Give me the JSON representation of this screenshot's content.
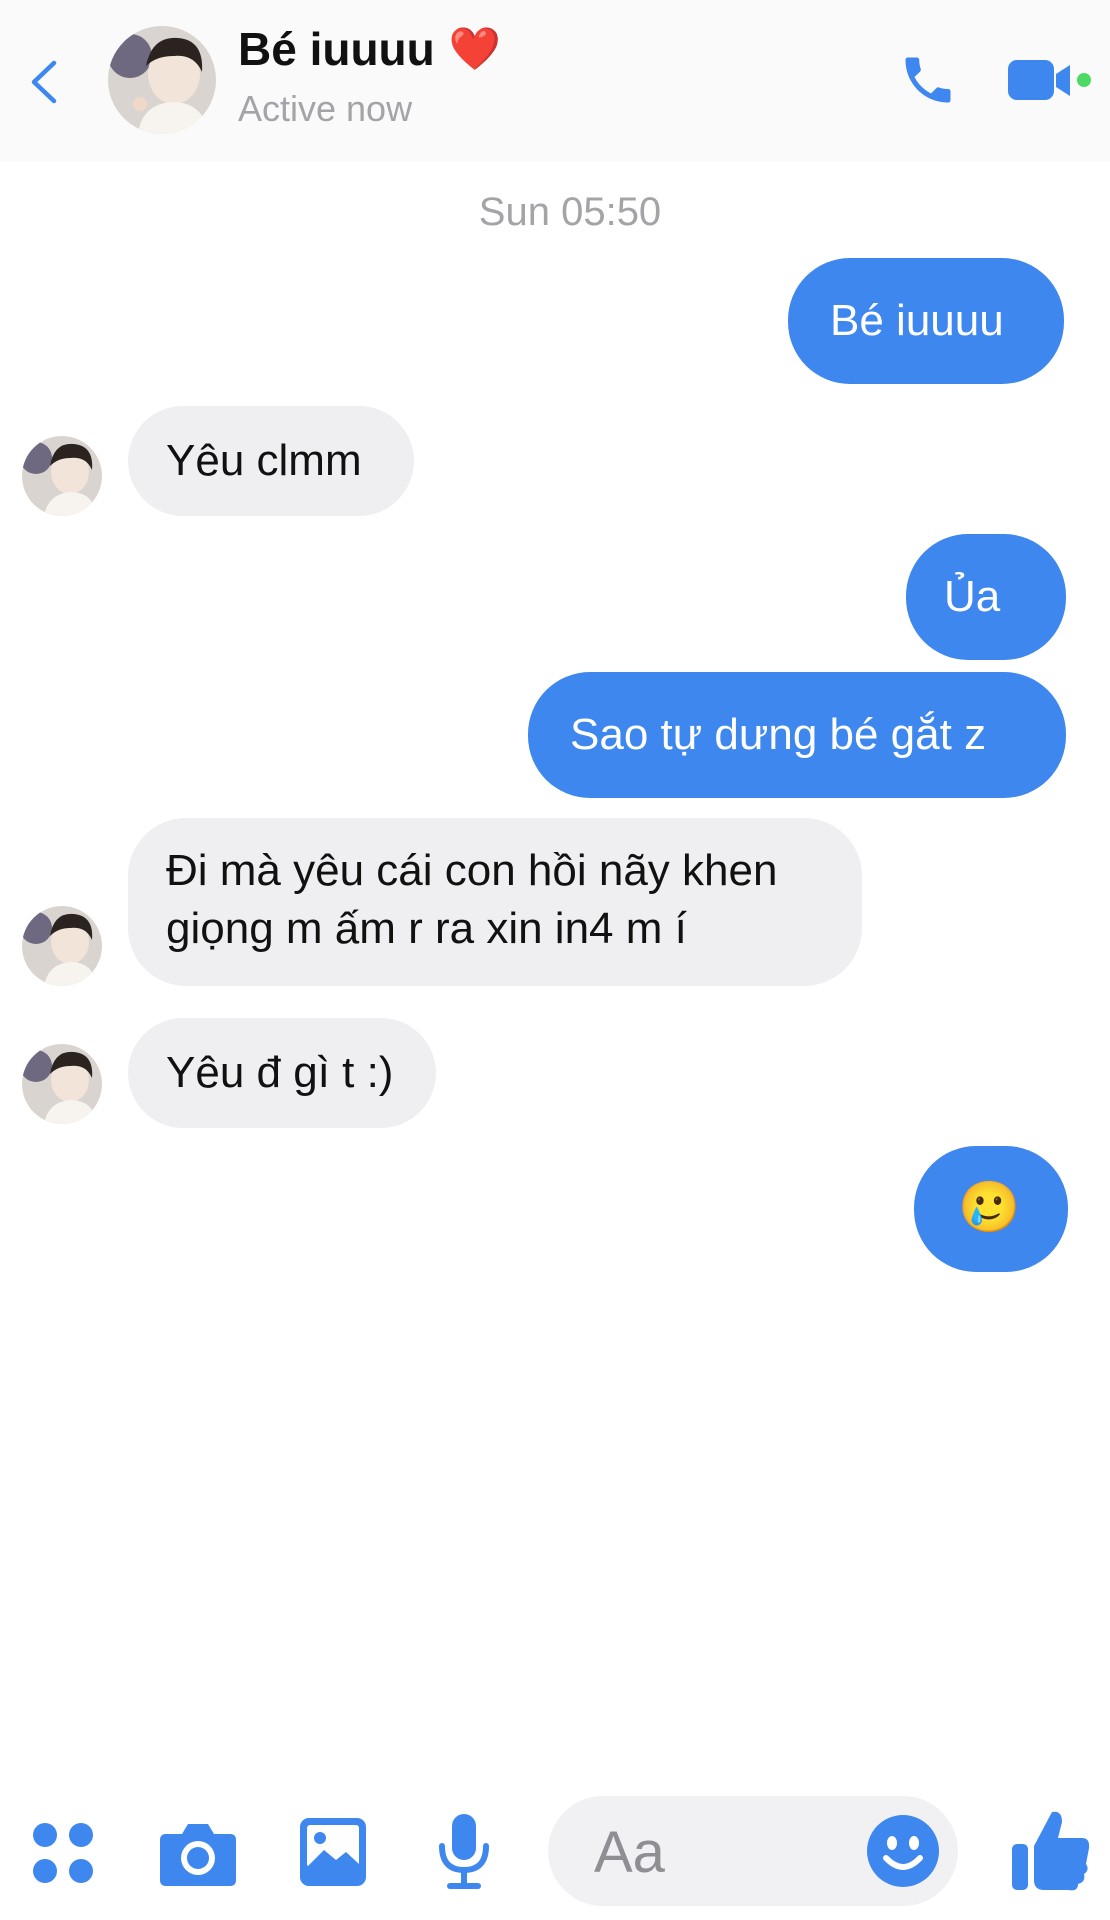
{
  "header": {
    "name": "Bé iuuuu",
    "status": "Active now",
    "heart_emoji": "❤️",
    "icons": [
      "back-chevron-icon",
      "phone-icon",
      "video-camera-icon"
    ],
    "online_color": "#4cd964"
  },
  "timestamp": "Sun 05:50",
  "messages": [
    {
      "direction": "outgoing",
      "text": "Bé iuuuu"
    },
    {
      "direction": "incoming",
      "text": "Yêu clmm"
    },
    {
      "direction": "outgoing",
      "text": "Ủa"
    },
    {
      "direction": "outgoing",
      "text": "Sao tự dưng bé gắt z"
    },
    {
      "direction": "incoming",
      "line1": "Đi mà yêu cái con hồi nãy khen",
      "line2": "giọng m ấm r ra xin in4 m í"
    },
    {
      "direction": "incoming",
      "text": "Yêu đ gì t :)"
    },
    {
      "direction": "outgoing",
      "emoji": "🥲"
    }
  ],
  "composer": {
    "placeholder": "Aa",
    "icons": [
      "apps-grid-icon",
      "camera-icon",
      "photo-icon",
      "microphone-icon",
      "emoji-icon",
      "thumbs-up-icon"
    ]
  },
  "colors": {
    "accent": "#3d87ee",
    "outgoing_bubble": "#3d87ee",
    "incoming_bubble": "#efeff1"
  }
}
